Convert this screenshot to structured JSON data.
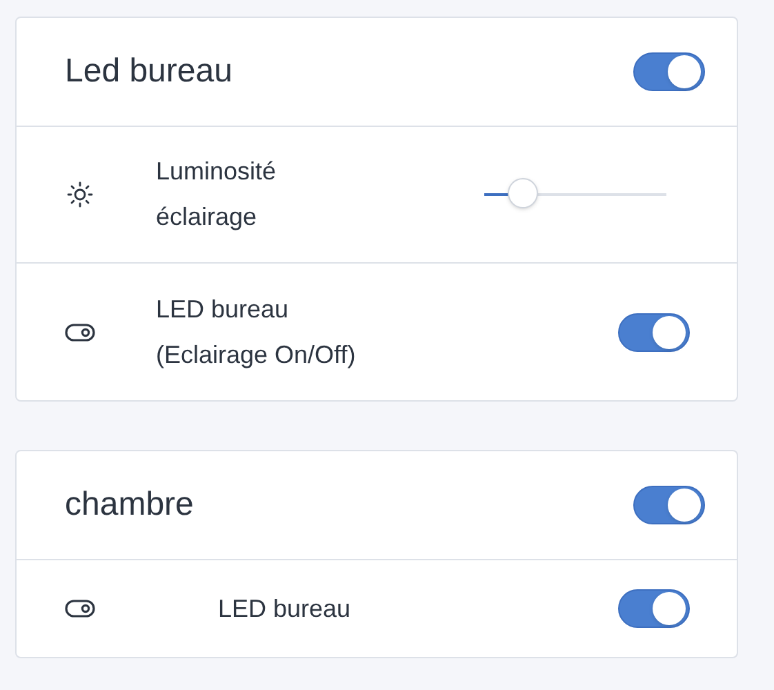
{
  "cards": [
    {
      "title": "Led bureau",
      "on": true,
      "rows": [
        {
          "kind": "slider",
          "label": [
            "Luminosité",
            "éclairage"
          ],
          "level": 0.21
        },
        {
          "kind": "toggle",
          "label": [
            "LED bureau",
            "(Eclairage On/Off)"
          ],
          "on": true
        }
      ]
    },
    {
      "title": "chambre",
      "on": true,
      "rows": [
        {
          "kind": "toggle",
          "label": [
            "LED bureau"
          ],
          "on": true
        }
      ]
    }
  ]
}
